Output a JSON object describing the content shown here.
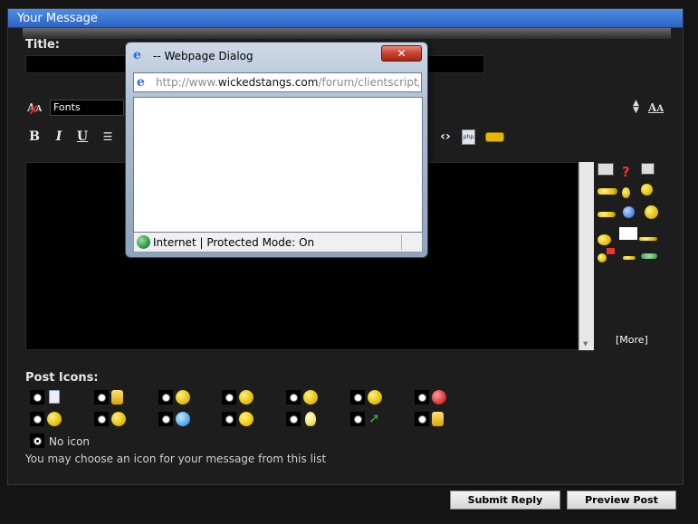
{
  "panel": {
    "header": "Your Message",
    "title_label": "Title:",
    "title_value": ""
  },
  "toolbar": {
    "font_select": "Fonts",
    "more_smilies": "[More]"
  },
  "post_icons": {
    "label": "Post Icons:",
    "no_icon_label": "No icon",
    "selected": "No icon",
    "hint": "You may choose an icon for your message from this list",
    "icons": [
      "document-icon",
      "thumbs-down-icon",
      "wink-icon",
      "smile-icon",
      "grin-icon",
      "frown-icon",
      "angry-icon",
      "cheerful-icon",
      "cool-icon",
      "question-icon",
      "exclamation-icon",
      "lightbulb-icon",
      "arrow-icon",
      "thumbs-up-icon"
    ]
  },
  "buttons": {
    "submit": "Submit Reply",
    "preview": "Preview Post"
  },
  "dialog": {
    "title": "-- Webpage Dialog",
    "close": "✕",
    "url_prefix": "http://www.",
    "url_domain": "wickedstangs.com",
    "url_rest": "/forum/clientscript/iepr",
    "status": "Internet | Protected Mode: On"
  },
  "colors": {
    "header_blue": "#2b63c6",
    "background": "#1d1d1d",
    "close_red": "#c9412f"
  }
}
